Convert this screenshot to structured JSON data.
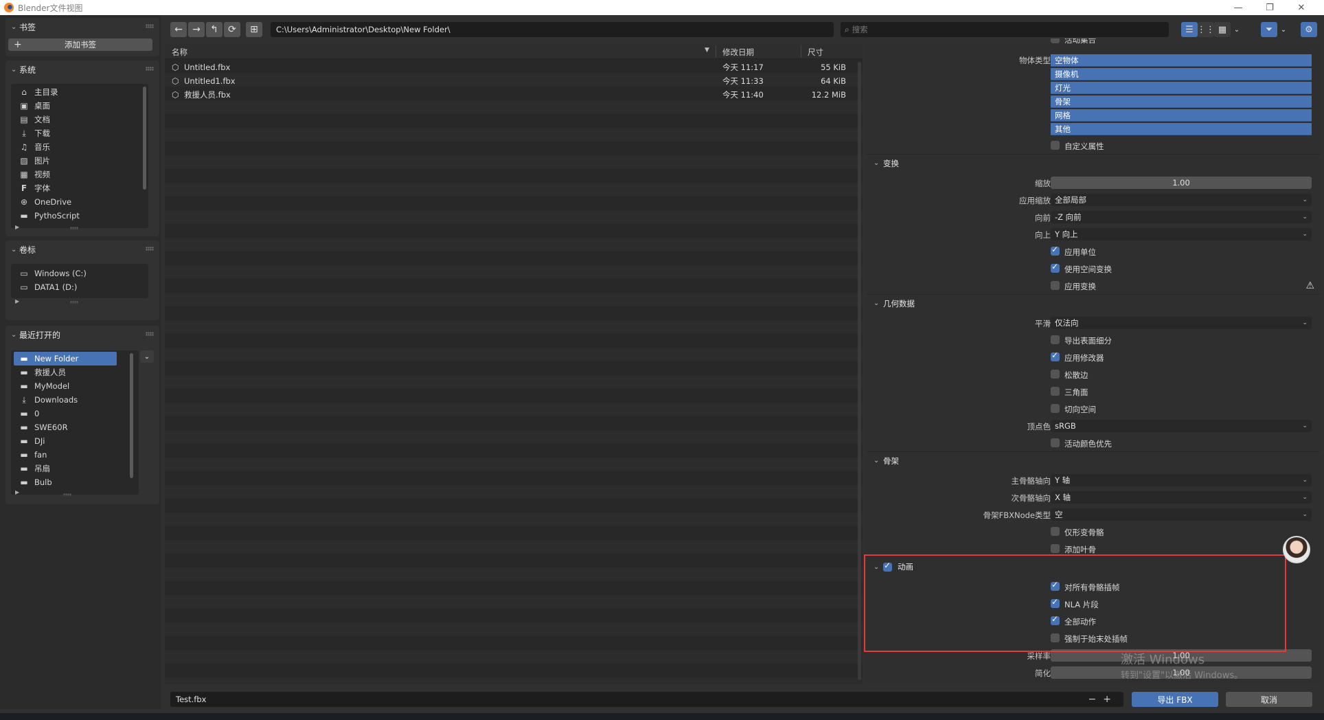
{
  "window": {
    "title": "Blender文件视图",
    "controls": [
      "—",
      "❐",
      "✕"
    ]
  },
  "sidebar": {
    "bookmarks": {
      "title": "书签",
      "add_label": "添加书签"
    },
    "system": {
      "title": "系统",
      "items": [
        {
          "icon": "⌂",
          "label": "主目录"
        },
        {
          "icon": "▣",
          "label": "桌面"
        },
        {
          "icon": "▤",
          "label": "文档"
        },
        {
          "icon": "⤓",
          "label": "下载"
        },
        {
          "icon": "♫",
          "label": "音乐"
        },
        {
          "icon": "▨",
          "label": "图片"
        },
        {
          "icon": "▦",
          "label": "视频"
        },
        {
          "icon": "F",
          "label": "字体"
        },
        {
          "icon": "⊕",
          "label": "OneDrive"
        },
        {
          "icon": "▬",
          "label": "PythoScript"
        }
      ]
    },
    "volumes": {
      "title": "卷标",
      "items": [
        {
          "icon": "▭",
          "label": "Windows (C:)"
        },
        {
          "icon": "▭",
          "label": "DATA1 (D:)"
        }
      ]
    },
    "recent": {
      "title": "最近打开的",
      "items": [
        {
          "icon": "▬",
          "label": "New Folder",
          "selected": true
        },
        {
          "icon": "▬",
          "label": "救援人员"
        },
        {
          "icon": "▬",
          "label": "MyModel"
        },
        {
          "icon": "⤓",
          "label": "Downloads"
        },
        {
          "icon": "▬",
          "label": "0"
        },
        {
          "icon": "▬",
          "label": "SWE60R"
        },
        {
          "icon": "▬",
          "label": "DJi"
        },
        {
          "icon": "▬",
          "label": "fan"
        },
        {
          "icon": "▬",
          "label": "吊扇"
        },
        {
          "icon": "▬",
          "label": "Bulb"
        }
      ]
    }
  },
  "toolbar": {
    "path": "C:\\Users\\Administrator\\Desktop\\New Folder\\",
    "search_placeholder": "搜索",
    "nav_icons": [
      "←",
      "→",
      "↰",
      "⟳",
      "⊞"
    ]
  },
  "filelist": {
    "columns": {
      "name": "名称",
      "date": "修改日期",
      "size": "尺寸"
    },
    "files": [
      {
        "name": "Untitled.fbx",
        "date": "今天 11:17",
        "size": "55 KiB"
      },
      {
        "name": "Untitled1.fbx",
        "date": "今天 11:33",
        "size": "64 KiB"
      },
      {
        "name": "救援人员.fbx",
        "date": "今天 11:40",
        "size": "12.2 MiB"
      }
    ]
  },
  "props": {
    "cutoff_top_label": "活动集合",
    "object_types_label": "物体类型",
    "object_types": [
      "空物体",
      "摄像机",
      "灯光",
      "骨架",
      "网格",
      "其他"
    ],
    "custom_props": "自定义属性",
    "transform": {
      "title": "变换",
      "scale_label": "缩放",
      "scale_value": "1.00",
      "apply_scale_label": "应用缩放",
      "apply_scale_value": "全部局部",
      "forward_label": "向前",
      "forward_value": "-Z 向前",
      "up_label": "向上",
      "up_value": "Y 向上",
      "apply_unit": "应用单位",
      "use_space_transform": "使用空间变换",
      "apply_transform": "应用变换"
    },
    "geometry": {
      "title": "几何数据",
      "smoothing_label": "平滑",
      "smoothing_value": "仅法向",
      "export_subdiv": "导出表面细分",
      "apply_modifiers": "应用修改器",
      "loose_edges": "松散边",
      "triangulate": "三角面",
      "tangent_space": "切向空间",
      "vertex_color_label": "顶点色",
      "vertex_color_value": "sRGB",
      "active_color_first": "活动颜色优先"
    },
    "armature": {
      "title": "骨架",
      "primary_axis_label": "主骨骼轴向",
      "primary_axis_value": "Y 轴",
      "secondary_axis_label": "次骨骼轴向",
      "secondary_axis_value": "X 轴",
      "node_type_label": "骨架FBXNode类型",
      "node_type_value": "空",
      "deform_only": "仅形变骨骼",
      "add_leaf": "添加叶骨"
    },
    "animation": {
      "title": "动画",
      "key_all_bones": "对所有骨骼插帧",
      "nla_strips": "NLA 片段",
      "all_actions": "全部动作",
      "force_start_end": "强制于始末处插帧",
      "sampling_label": "采样率",
      "sampling_value": "1.00",
      "simplify_label": "简化",
      "simplify_value": "1.00"
    },
    "watermark_line1": "激活 Windows",
    "watermark_line2": "转到\"设置\"以激活 Windows。"
  },
  "bottom": {
    "filename": "Test.fbx",
    "export_label": "导出 FBX",
    "cancel_label": "取消"
  }
}
